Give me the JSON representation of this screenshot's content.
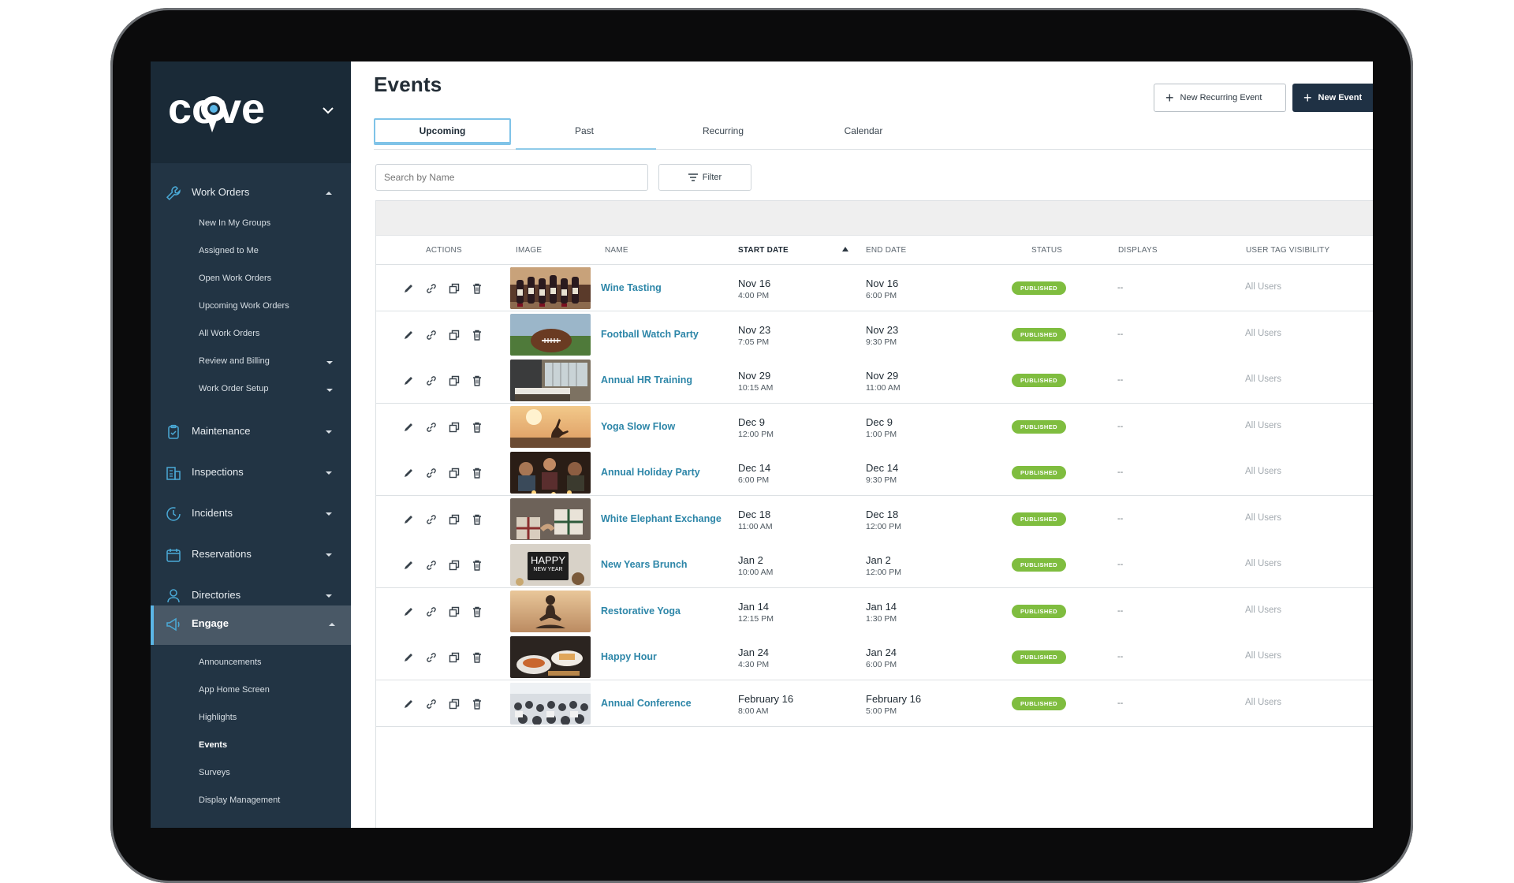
{
  "app": {
    "logo_text": "cove"
  },
  "sidebar": {
    "sections": [
      {
        "label": "Work Orders",
        "icon": "wrench-icon",
        "expanded": true
      },
      {
        "label": "Maintenance",
        "icon": "clipboard-icon"
      },
      {
        "label": "Inspections",
        "icon": "building-icon"
      },
      {
        "label": "Incidents",
        "icon": "clock-alert-icon"
      },
      {
        "label": "Reservations",
        "icon": "calendar-icon"
      },
      {
        "label": "Directories",
        "icon": "person-icon"
      },
      {
        "label": "Engage",
        "icon": "megaphone-icon",
        "active": true
      }
    ],
    "work_orders_items": [
      {
        "label": "New In My Groups"
      },
      {
        "label": "Assigned to Me"
      },
      {
        "label": "Open Work Orders"
      },
      {
        "label": "Upcoming Work Orders"
      },
      {
        "label": "All Work Orders"
      },
      {
        "label": "Review and Billing"
      },
      {
        "label": "Work Order Setup"
      }
    ],
    "engage_items": [
      {
        "label": "Announcements"
      },
      {
        "label": "App Home Screen"
      },
      {
        "label": "Highlights"
      },
      {
        "label": "Events",
        "active": true
      },
      {
        "label": "Surveys"
      },
      {
        "label": "Display Management"
      }
    ]
  },
  "main": {
    "title": "Events",
    "new_recurring_label": "New Recurring Event",
    "new_event_label": "New Event",
    "tabs": [
      {
        "label": "Upcoming",
        "active": true
      },
      {
        "label": "Past"
      },
      {
        "label": "Recurring"
      },
      {
        "label": "Calendar"
      }
    ],
    "search_placeholder": "Search by Name",
    "filter_label": "Filter"
  },
  "table": {
    "columns": {
      "actions": "ACTIONS",
      "image": "IMAGE",
      "name": "NAME",
      "start_date": "START DATE",
      "end_date": "END DATE",
      "status": "STATUS",
      "displays": "DISPLAYS",
      "visibility": "USER TAG VISIBILITY"
    },
    "rows": [
      {
        "name": "Wine Tasting",
        "start_date": "Nov 16",
        "start_time": "4:00 PM",
        "end_date": "Nov 16",
        "end_time": "6:00 PM",
        "status": "PUBLISHED",
        "displays": "--",
        "visibility": "All Users",
        "image": "wine"
      },
      {
        "name": "Football Watch Party",
        "start_date": "Nov 23",
        "start_time": "7:05 PM",
        "end_date": "Nov 23",
        "end_time": "9:30 PM",
        "status": "PUBLISHED",
        "displays": "--",
        "visibility": "All Users",
        "image": "football"
      },
      {
        "name": "Annual HR Training",
        "start_date": "Nov 29",
        "start_time": "10:15 AM",
        "end_date": "Nov 29",
        "end_time": "11:00 AM",
        "status": "PUBLISHED",
        "displays": "--",
        "visibility": "All Users",
        "image": "office"
      },
      {
        "name": "Yoga Slow Flow",
        "start_date": "Dec 9",
        "start_time": "12:00 PM",
        "end_date": "Dec 9",
        "end_time": "1:00 PM",
        "status": "PUBLISHED",
        "displays": "--",
        "visibility": "All Users",
        "image": "sunset-yoga"
      },
      {
        "name": "Annual Holiday Party",
        "start_date": "Dec 14",
        "start_time": "6:00 PM",
        "end_date": "Dec 14",
        "end_time": "9:30 PM",
        "status": "PUBLISHED",
        "displays": "--",
        "visibility": "All Users",
        "image": "party"
      },
      {
        "name": "White Elephant Exchange",
        "start_date": "Dec 18",
        "start_time": "11:00 AM",
        "end_date": "Dec 18",
        "end_time": "12:00 PM",
        "status": "PUBLISHED",
        "displays": "--",
        "visibility": "All Users",
        "image": "gifts"
      },
      {
        "name": "New Years Brunch",
        "start_date": "Jan 2",
        "start_time": "10:00 AM",
        "end_date": "Jan 2",
        "end_time": "12:00 PM",
        "status": "PUBLISHED",
        "displays": "--",
        "visibility": "All Users",
        "image": "happy-new-year",
        "image_text": "HAPPY",
        "image_subtext": "NEW YEAR"
      },
      {
        "name": "Restorative Yoga",
        "start_date": "Jan 14",
        "start_time": "12:15 PM",
        "end_date": "Jan 14",
        "end_time": "1:30 PM",
        "status": "PUBLISHED",
        "displays": "--",
        "visibility": "All Users",
        "image": "meditation"
      },
      {
        "name": "Happy Hour",
        "start_date": "Jan 24",
        "start_time": "4:30 PM",
        "end_date": "Jan 24",
        "end_time": "6:00 PM",
        "status": "PUBLISHED",
        "displays": "--",
        "visibility": "All Users",
        "image": "food"
      },
      {
        "name": "Annual Conference",
        "start_date": "February 16",
        "start_time": "8:00 AM",
        "end_date": "February 16",
        "end_time": "5:00 PM",
        "status": "PUBLISHED",
        "displays": "--",
        "visibility": "All Users",
        "image": "crowd"
      }
    ]
  },
  "colors": {
    "sidebar": "#223444",
    "accent": "#5bb6e6",
    "link": "#2d86a8",
    "status_green": "#7fbd3f",
    "primary_button": "#1f3144"
  }
}
